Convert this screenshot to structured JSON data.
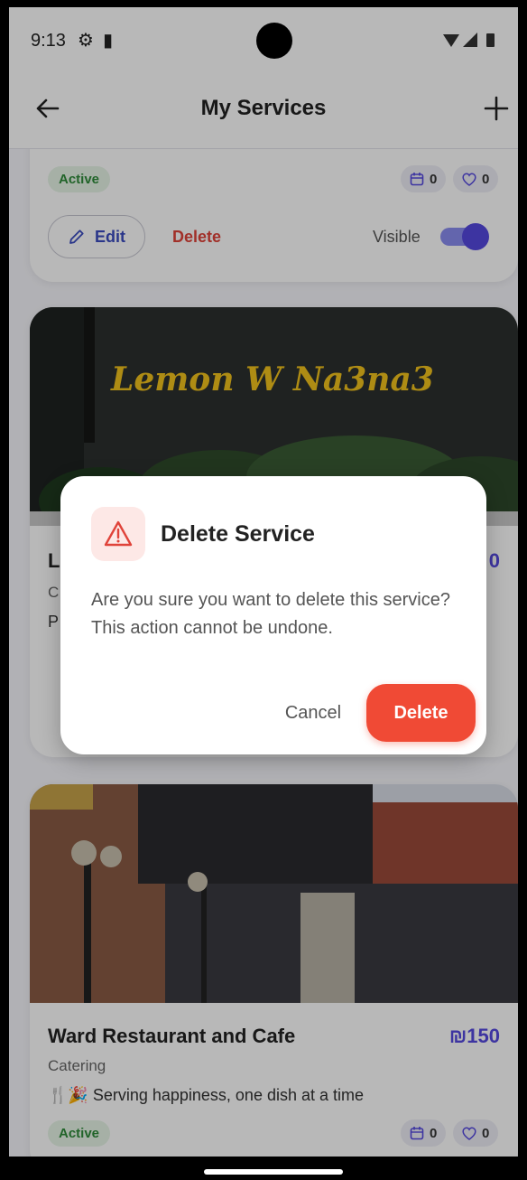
{
  "status_bar": {
    "time": "9:13"
  },
  "app_bar": {
    "title": "My Services"
  },
  "cards": [
    {
      "status": "Active",
      "bookings": "0",
      "likes": "0",
      "edit_label": "Edit",
      "delete_label": "Delete",
      "visible_label": "Visible",
      "visible": true
    },
    {
      "title_partial": "L",
      "category_partial": "C",
      "desc_partial": "P",
      "price_partial": "0",
      "image_text": "Lemon W Na3na3"
    },
    {
      "title": "Ward Restaurant and Cafe",
      "price": "₪150",
      "category": "Catering",
      "description": "🍴🎉 Serving happiness, one dish at a time",
      "status": "Active",
      "bookings": "0",
      "likes": "0"
    }
  ],
  "dialog": {
    "title": "Delete Service",
    "message": "Are you sure you want to delete this service? This action cannot be undone.",
    "cancel_label": "Cancel",
    "confirm_label": "Delete"
  },
  "icons": {
    "back": "arrow-left-icon",
    "add": "plus-icon",
    "calendar": "calendar-icon",
    "heart": "heart-icon",
    "pencil": "pencil-icon",
    "warning": "warning-icon"
  },
  "colors": {
    "accent": "#5548e0",
    "danger": "#f04a35",
    "active_text": "#2e8b3a",
    "active_bg": "#e6f4e7"
  }
}
